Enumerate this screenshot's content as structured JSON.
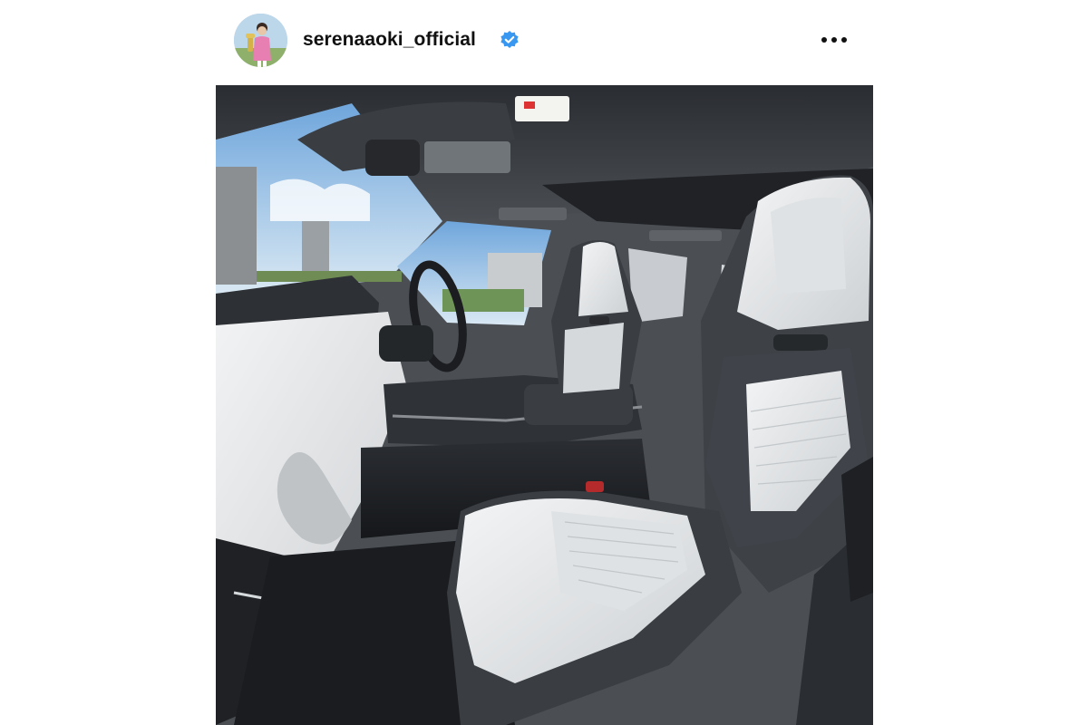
{
  "post": {
    "username": "serenaaoki_official",
    "verified": true,
    "avatar_icon": "profile-photo-avatar",
    "more_icon": "more-options-icon",
    "media_alt": "car-interior-photo"
  },
  "colors": {
    "verified_badge": "#3897f0",
    "text": "#111111",
    "seat_light": "#e9ecee",
    "seat_dark": "#3c4045"
  }
}
